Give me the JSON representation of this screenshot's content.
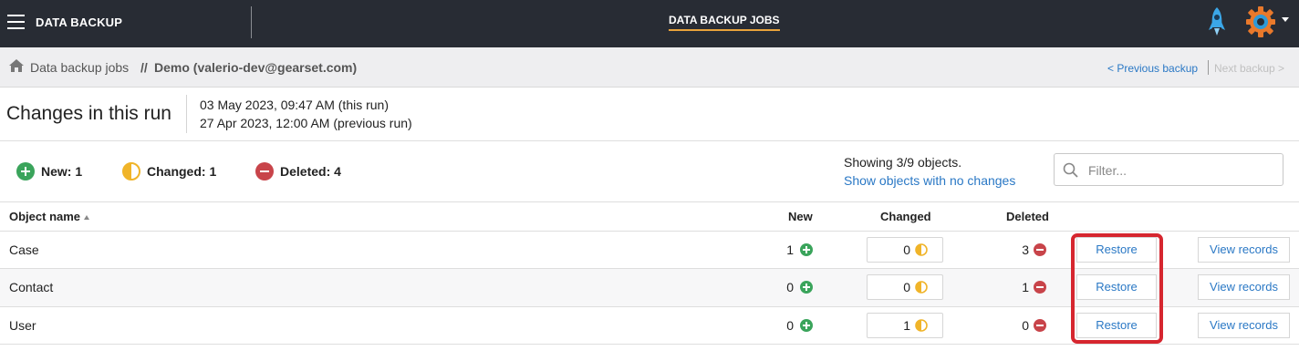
{
  "app": {
    "title": "DATA BACKUP",
    "nav_tab": "DATA BACKUP JOBS"
  },
  "breadcrumb": {
    "root": "Data backup jobs",
    "separator": "//",
    "current": "Demo (valerio-dev@gearset.com)",
    "prev": "< Previous backup",
    "next": "Next backup >"
  },
  "run": {
    "title": "Changes in this run",
    "this_run": "03 May 2023, 09:47 AM (this run)",
    "previous_run": "27 Apr 2023, 12:00 AM (previous run)"
  },
  "summary": {
    "new_label": "New: 1",
    "changed_label": "Changed: 1",
    "deleted_label": "Deleted: 4",
    "showing": "Showing 3/9 objects.",
    "show_link": "Show objects with no changes"
  },
  "filter": {
    "placeholder": "Filter..."
  },
  "table": {
    "headers": {
      "name": "Object name",
      "new": "New",
      "changed": "Changed",
      "deleted": "Deleted"
    },
    "rows": [
      {
        "name": "Case",
        "new": "1",
        "changed": "0",
        "deleted": "3",
        "restore": "Restore",
        "view": "View records"
      },
      {
        "name": "Contact",
        "new": "0",
        "changed": "0",
        "deleted": "1",
        "restore": "Restore",
        "view": "View records"
      },
      {
        "name": "User",
        "new": "0",
        "changed": "1",
        "deleted": "0",
        "restore": "Restore",
        "view": "View records"
      }
    ]
  },
  "colors": {
    "new": "#3aa45b",
    "changed": "#f0b429",
    "deleted": "#c8444a",
    "link": "#2a78c5",
    "highlight": "#d6262f"
  }
}
